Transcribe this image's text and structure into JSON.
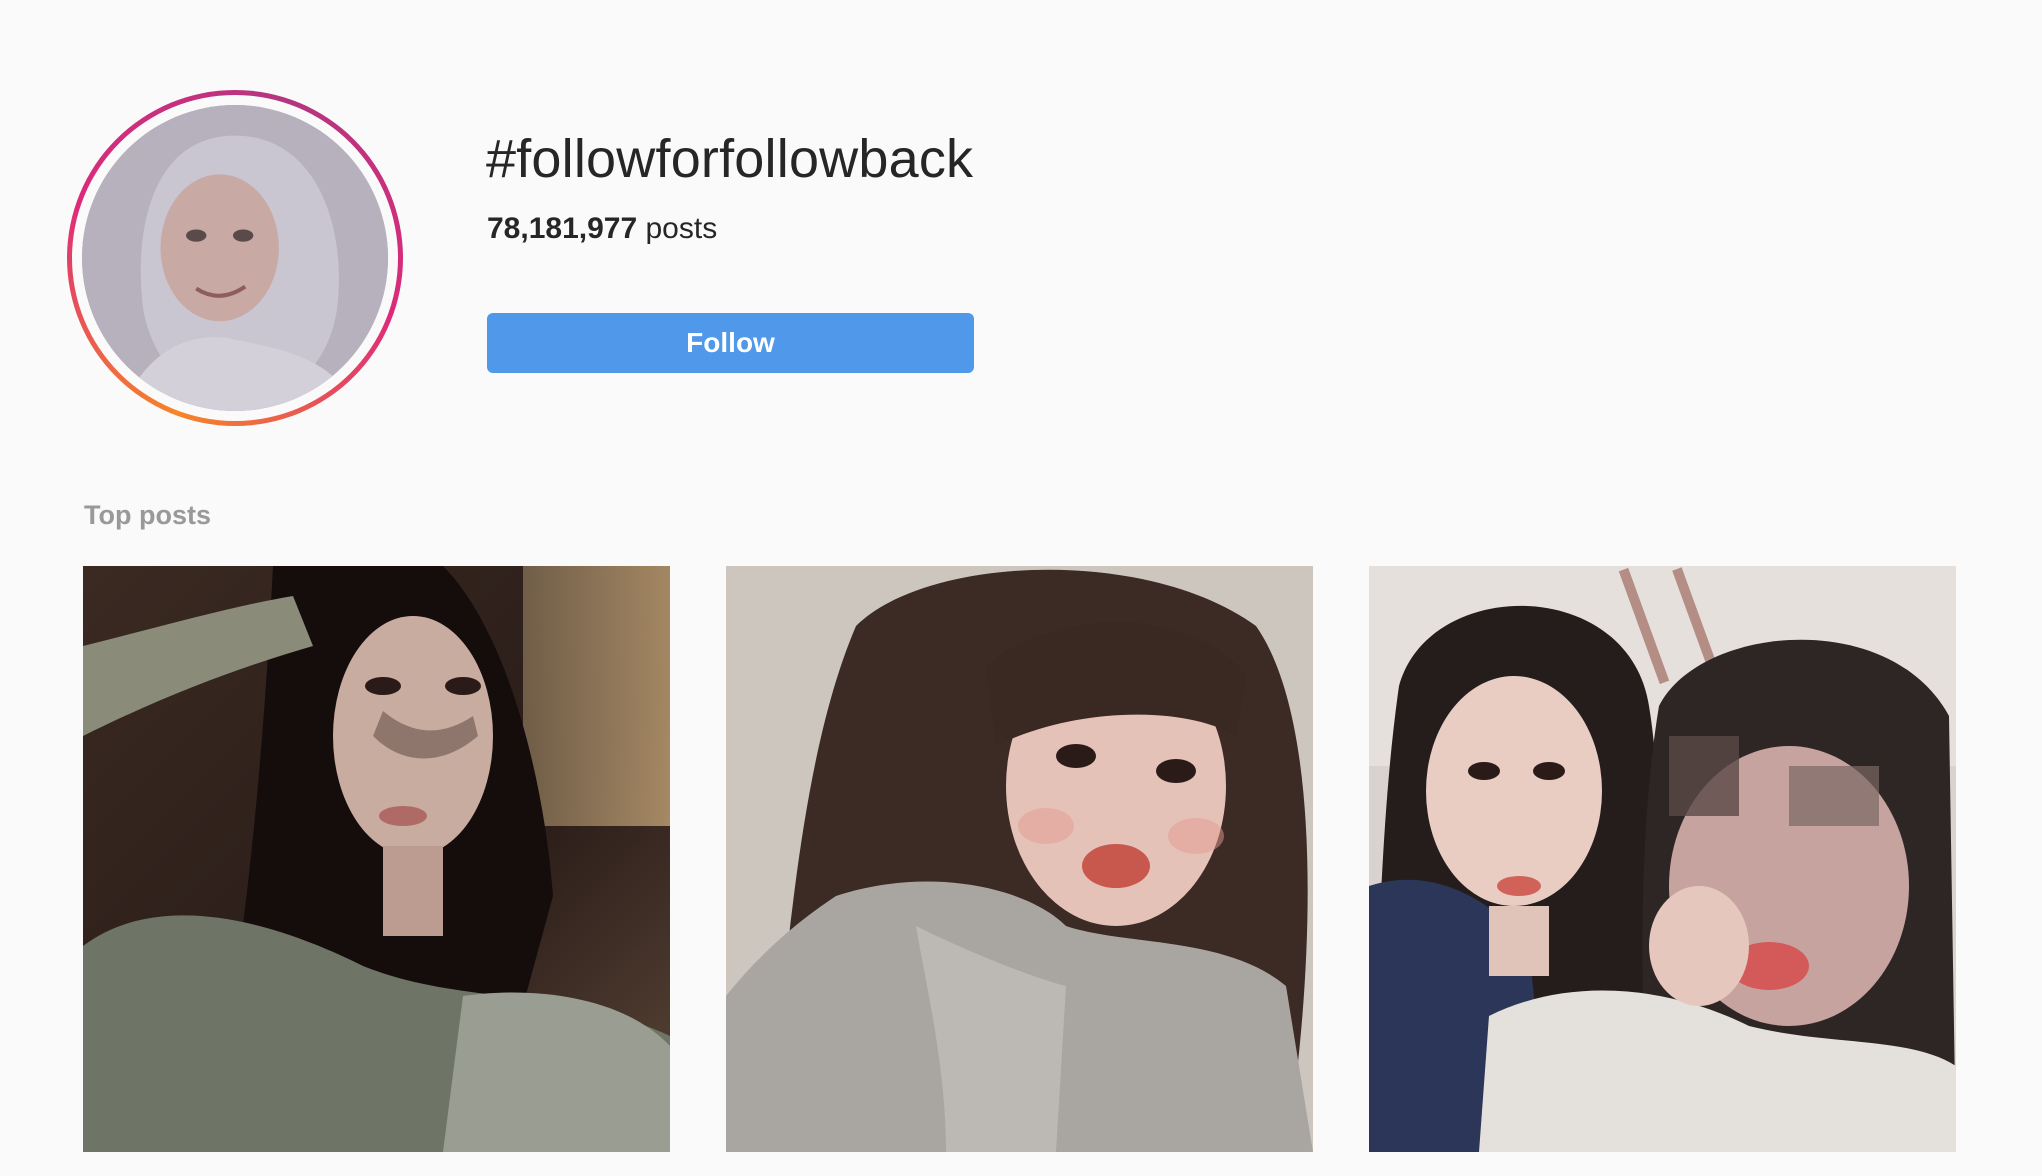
{
  "hashtag": {
    "title": "#followforfollowback",
    "post_count": "78,181,977",
    "post_count_suffix": "posts",
    "follow_label": "Follow"
  },
  "sections": {
    "top_posts_label": "Top posts"
  },
  "top_posts": [
    {
      "image": "post-photo-1"
    },
    {
      "image": "post-photo-2"
    },
    {
      "image": "post-photo-3"
    }
  ],
  "colors": {
    "background": "#fafafa",
    "follow_button": "#4f98ea",
    "section_label": "#999999",
    "text": "#262626",
    "ring_gradient": [
      "#f58529",
      "#dd2a7b"
    ]
  }
}
